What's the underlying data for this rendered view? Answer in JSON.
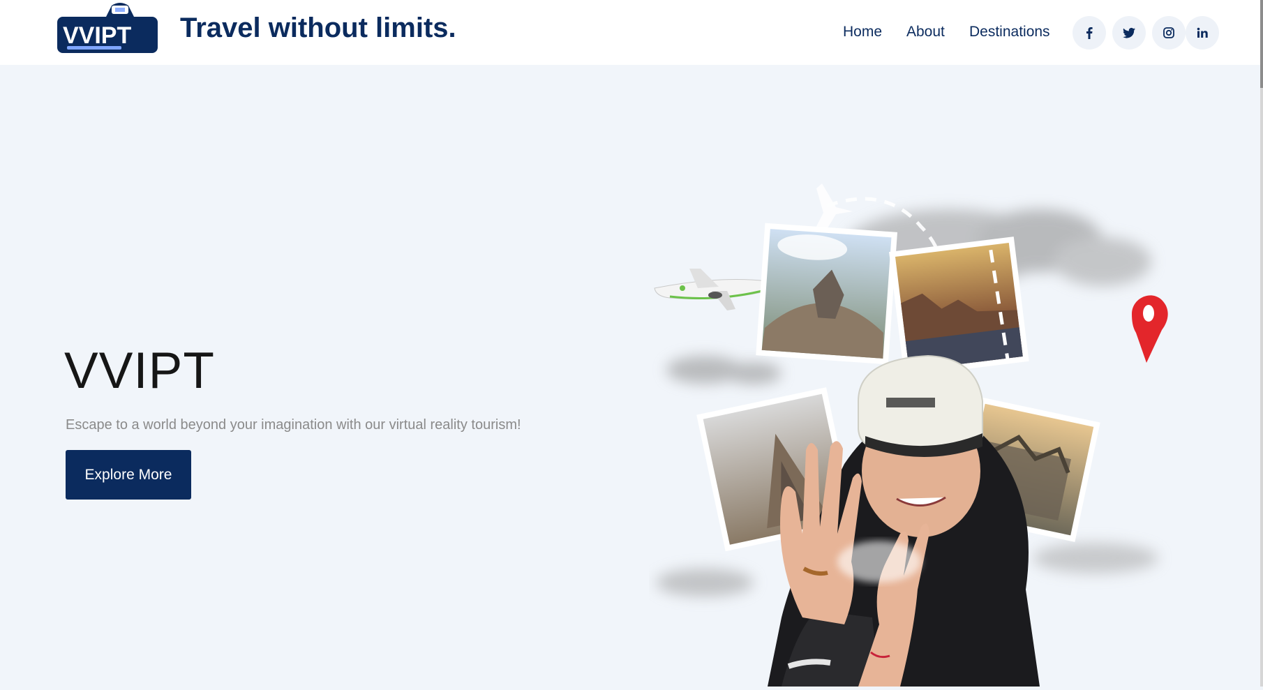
{
  "header": {
    "logo_text": "VVIPT",
    "tagline": "Travel without limits.",
    "nav": [
      {
        "label": "Home"
      },
      {
        "label": "About"
      },
      {
        "label": "Destinations"
      }
    ],
    "social": [
      {
        "icon": "facebook-icon"
      },
      {
        "icon": "twitter-icon"
      },
      {
        "icon": "instagram-icon"
      },
      {
        "icon": "linkedin-icon"
      }
    ]
  },
  "hero": {
    "title": "VVIPT",
    "subtitle": "Escape to a world beyond your imagination with our virtual reality tourism!",
    "cta_label": "Explore More",
    "image_alt": "Woman wearing VR headset surrounded by travel photos"
  },
  "colors": {
    "brand_navy": "#0b2b5e",
    "page_background": "#f1f5fa",
    "pin_red": "#e3262b"
  }
}
